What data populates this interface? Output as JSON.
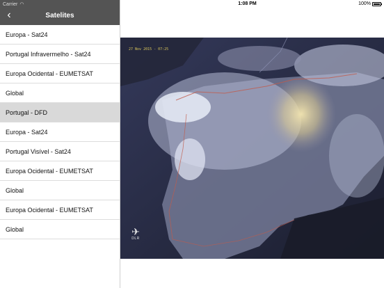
{
  "status_bar": {
    "carrier": "Carrier",
    "time": "1:08 PM",
    "battery": "100%",
    "battery_level": 1.0
  },
  "sidebar": {
    "title": "Satelites",
    "items": [
      {
        "label": "Europa - Sat24"
      },
      {
        "label": "Portugal Infravermelho - Sat24"
      },
      {
        "label": "Europa Ocidental - EUMETSAT"
      },
      {
        "label": "Global"
      },
      {
        "label": "Portugal - DFD"
      },
      {
        "label": "Europa - Sat24"
      },
      {
        "label": "Portugal Visível - Sat24"
      },
      {
        "label": "Europa Ocidental - EUMETSAT"
      },
      {
        "label": "Global"
      },
      {
        "label": "Europa Ocidental - EUMETSAT"
      },
      {
        "label": "Global"
      }
    ],
    "selected_index": 4
  },
  "image": {
    "timestamp": "27 Nov 2015 - 07:25",
    "logo_text": "DLR"
  },
  "colors": {
    "header_bg": "#545454",
    "selected_row": "#d9d9d9",
    "timestamp": "#d8c45a"
  },
  "icons": [
    "wifi-icon",
    "back-chevron-icon",
    "battery-icon",
    "dlr-logo-icon"
  ]
}
